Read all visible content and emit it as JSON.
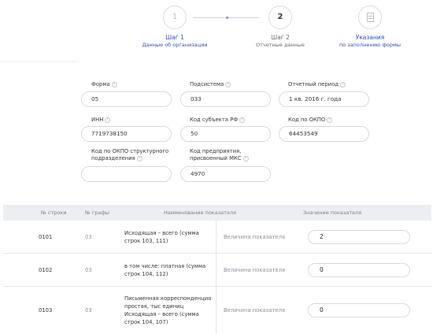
{
  "stepper": {
    "steps": [
      {
        "number": "1",
        "title": "Шаг 1",
        "subtitle": "Данные об организации"
      },
      {
        "number": "2",
        "title": "Шаг 2",
        "subtitle": "Отчетные данные"
      },
      {
        "title": "Указания",
        "subtitle": "по заполнению формы",
        "icon": "document-icon"
      }
    ]
  },
  "form": {
    "forma": {
      "label": "Форма",
      "value": "05"
    },
    "podsistema": {
      "label": "Подсистема",
      "value": "033"
    },
    "period": {
      "label": "Отчетный период",
      "value": "1 кв. 2016 г. года"
    },
    "inn": {
      "label": "ИНН",
      "value": "7719738150"
    },
    "subject": {
      "label": "Код субъекта РФ",
      "value": "50"
    },
    "okpo": {
      "label": "Код по ОКПО",
      "value": "64453549"
    },
    "okpo_struct": {
      "label_line1": "Код по ОКПО структурного",
      "label_line2": "подразделения",
      "value": ""
    },
    "mks": {
      "label_line1": "Код предприятия,",
      "label_line2": "присвоенный МКС",
      "value": "4970"
    }
  },
  "table": {
    "headers": {
      "row_no": "№ строки",
      "col_no": "№ графы",
      "name": "Наименование показателя",
      "value": "Значение показателя"
    },
    "rows": [
      {
        "row_no": "0101",
        "col_no": "03",
        "name": "Исходящая – всего (сумма строк 103, 111)",
        "measure": "Величина показателя",
        "value": "2"
      },
      {
        "row_no": "0102",
        "col_no": "03",
        "name": "в том числе: платная (сумма строк 104, 112)",
        "measure": "Величина показателя",
        "value": "0"
      },
      {
        "row_no": "0103",
        "col_no": "03",
        "name": "Письменная корреспонденция простая, тыс единиц Исходящая – всего (сумма строк 104, 107)",
        "measure": "Величина показателя",
        "value": "0"
      }
    ]
  },
  "colors": {
    "accent": "#2c4fa8",
    "border": "#d5d9e0",
    "header_bg": "#eceef2"
  }
}
